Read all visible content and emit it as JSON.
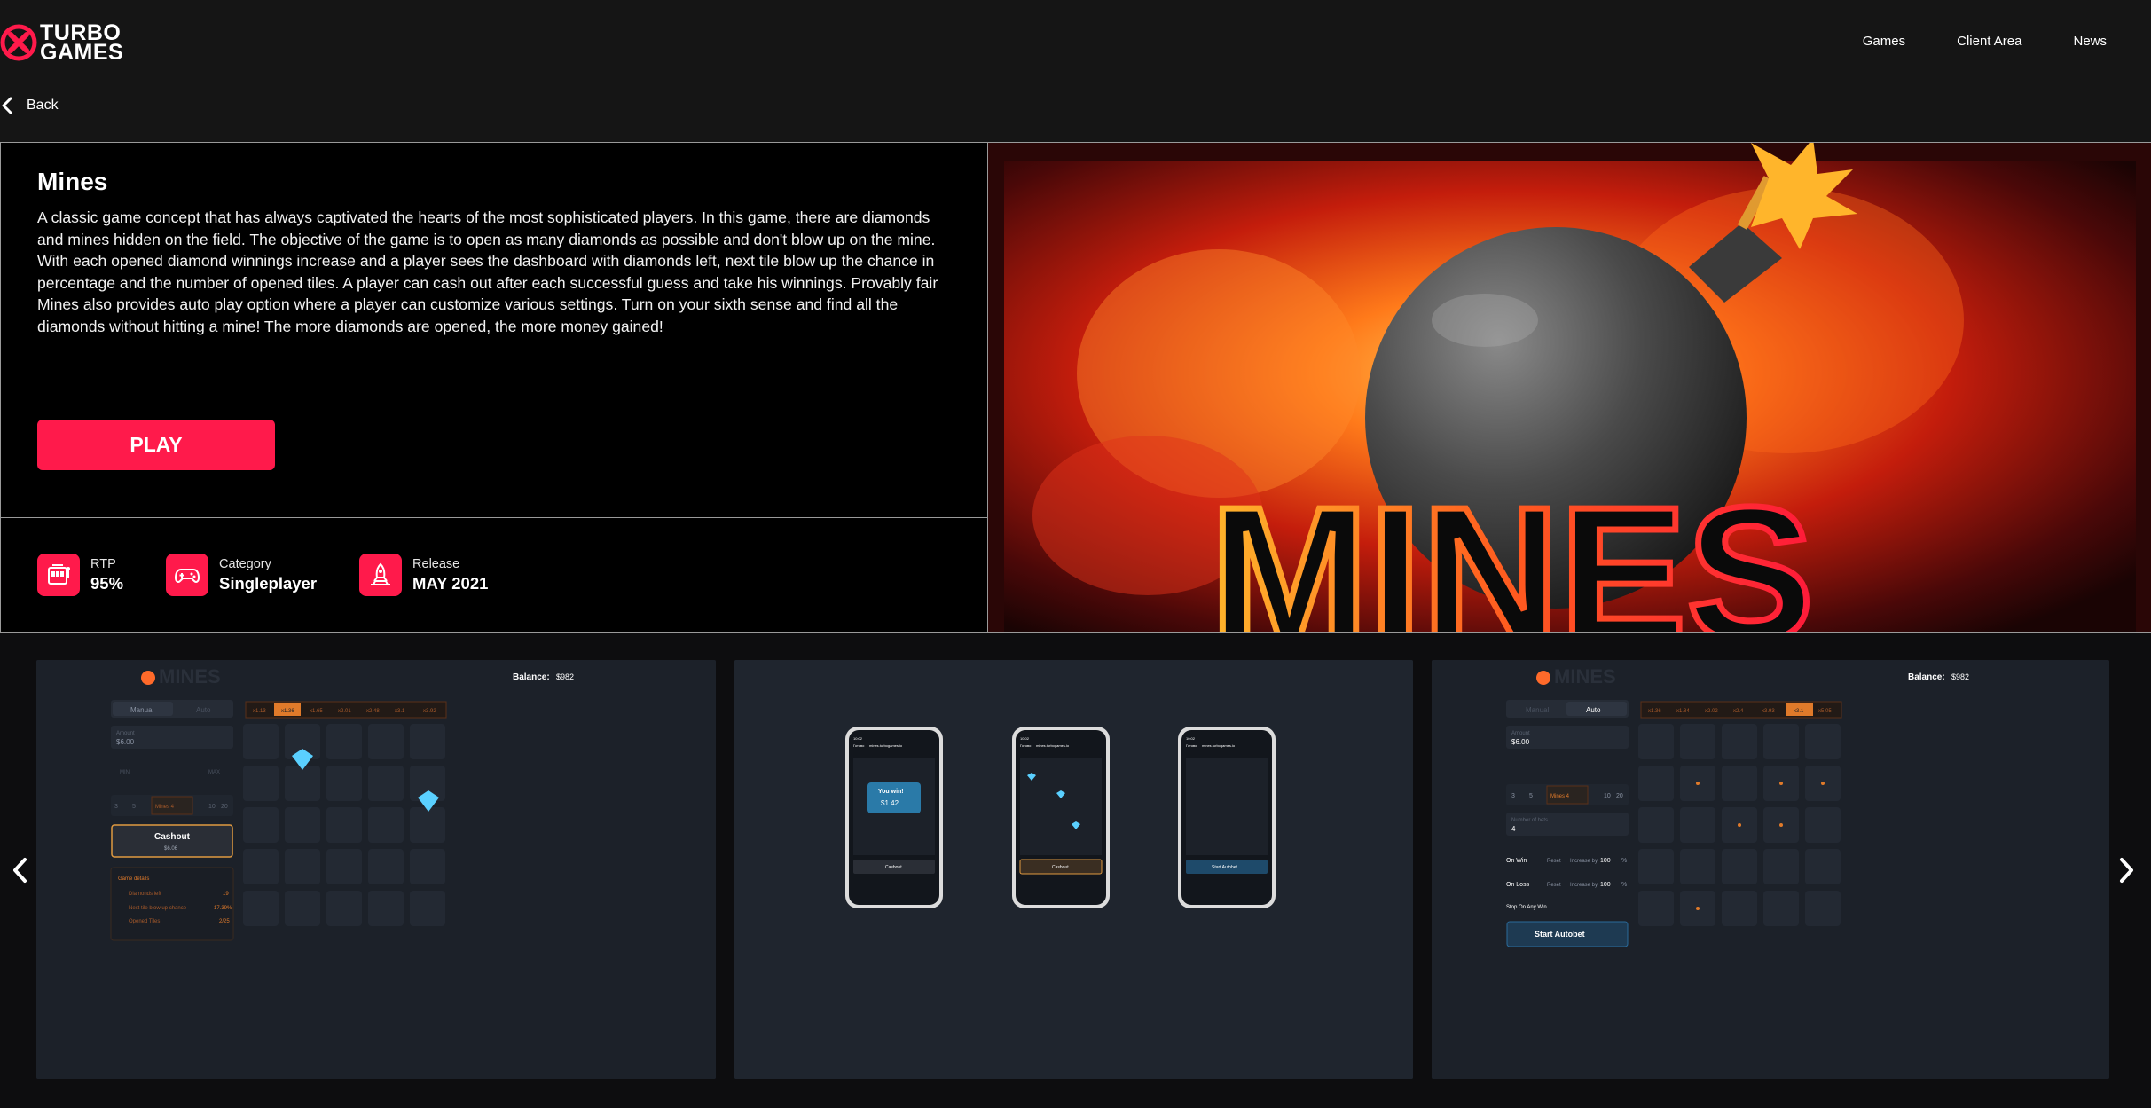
{
  "brand": {
    "logo_line1": "TURBO",
    "logo_line2": "GAMES",
    "logo_icon": "x-circle-icon",
    "accent": "#ff1a4b"
  },
  "nav": {
    "items": [
      {
        "label": "Games"
      },
      {
        "label": "Client Area"
      },
      {
        "label": "News"
      }
    ]
  },
  "back": {
    "label": "Back",
    "icon": "chevron-left-icon"
  },
  "game": {
    "title": "Mines",
    "description": "A classic game concept that has always captivated the hearts of the most sophisticated players. In this game, there are diamonds and mines hidden on the field. The objective of the game is to open as many diamonds as possible and don't blow up on the mine. With each opened diamond winnings increase and a player sees the dashboard with diamonds left, next tile blow up the chance in percentage and the number of opened tiles. A player can cash out after each successful guess and take his winnings. Provably fair Mines also provides auto play option where a player can customize various settings. Turn on your sixth sense and find all the diamonds without hitting a mine! The more diamonds are opened, the more money gained!",
    "play_label": "PLAY",
    "hero_text": "MINES"
  },
  "stats": [
    {
      "label": "RTP",
      "value": "95%",
      "icon": "slot-machine-icon"
    },
    {
      "label": "Category",
      "value": "Singleplayer",
      "icon": "gamepad-icon"
    },
    {
      "label": "Release",
      "value": "MAY 2021",
      "icon": "rocket-launch-icon"
    }
  ],
  "screenshots": {
    "shot1": {
      "logo": "MINES",
      "balance_label": "Balance:",
      "balance_value": "$982",
      "tabs": [
        "Manual",
        "Auto"
      ],
      "multipliers": [
        "x1.13",
        "x1.36",
        "x1.65",
        "x2.01",
        "x2.48",
        "x3.1",
        "x3.92"
      ],
      "amount_label": "Amount",
      "amount_value": "$6.00",
      "min_label": "MIN",
      "max_label": "MAX",
      "mines_buttons": [
        "3",
        "5",
        "",
        "Mines 4",
        "",
        "10",
        "20"
      ],
      "cashout_label": "Cashout",
      "cashout_value": "$6.06",
      "details_title": "Game details",
      "details": [
        {
          "label": "Diamonds left",
          "value": "19"
        },
        {
          "label": "Next tile blow up chance",
          "value": "17.39%"
        },
        {
          "label": "Opened Tiles",
          "value": "2/25"
        }
      ]
    },
    "shot2": {
      "phone_status": "10:02",
      "phone_tab": "Готово",
      "phone_url": "mines.turbogames.io",
      "win_title": "You win!",
      "win_amount": "$1.42",
      "buttons": [
        "Cashout",
        "Cashout",
        "Start Autobet"
      ]
    },
    "shot3": {
      "logo": "MINES",
      "balance_label": "Balance:",
      "balance_value": "$982",
      "tabs": [
        "Manual",
        "Auto"
      ],
      "multipliers": [
        "x1.36",
        "x1.84",
        "x2.02",
        "x2.4",
        "x3.1",
        "x3.93",
        "x5.05"
      ],
      "amount_label": "Amount",
      "amount_value": "$6.00",
      "mines_buttons": [
        "3",
        "5",
        "",
        "Mines 4",
        "",
        "10",
        "20"
      ],
      "bets_label": "Number of bets",
      "bets_value": "4",
      "on_win_label": "On Win",
      "on_loss_label": "On Loss",
      "reset_label": "Reset",
      "increase_label": "Increase by",
      "increase_value": "100",
      "percent": "%",
      "stop_label": "Stop On Any Win",
      "start_label": "Start Autobet"
    }
  }
}
